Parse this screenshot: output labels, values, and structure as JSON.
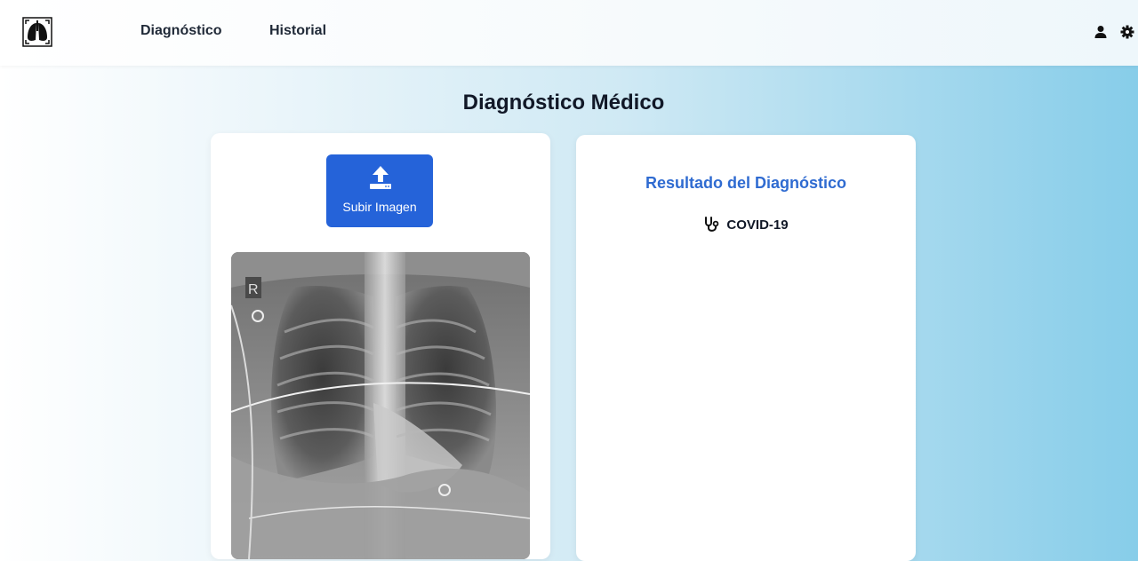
{
  "navbar": {
    "links": [
      {
        "label": "Diagnóstico"
      },
      {
        "label": "Historial"
      }
    ]
  },
  "page": {
    "title": "Diagnóstico Médico"
  },
  "upload": {
    "label": "Subir Imagen"
  },
  "xray_image": {
    "marker": "R"
  },
  "result": {
    "title": "Resultado del Diagnóstico",
    "value": "COVID-19"
  },
  "colors": {
    "primary": "#2563d9",
    "result_title": "#2f6bd1",
    "background_end": "#87cde9"
  },
  "icons": [
    "lungs-xray-logo-icon",
    "upload-icon",
    "user-icon",
    "gear-icon",
    "stethoscope-icon"
  ]
}
